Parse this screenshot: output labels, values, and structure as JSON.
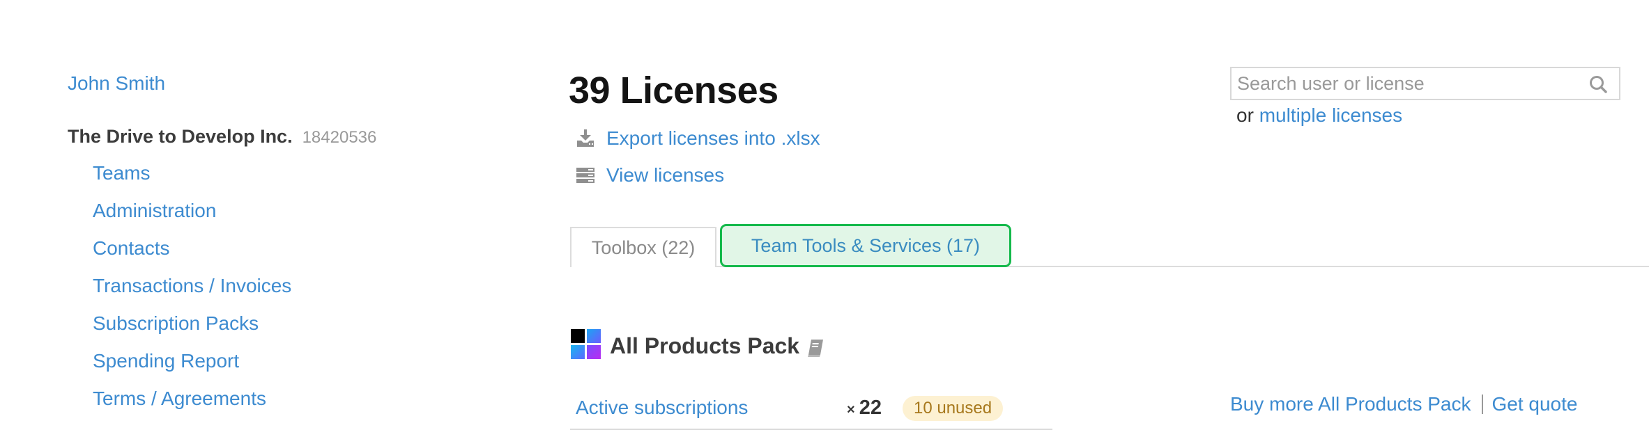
{
  "sidebar": {
    "user_name": "John Smith",
    "org_name": "The Drive to Develop Inc.",
    "org_id": "18420536",
    "items": [
      {
        "label": "Teams"
      },
      {
        "label": "Administration"
      },
      {
        "label": "Contacts"
      },
      {
        "label": "Transactions / Invoices"
      },
      {
        "label": "Subscription Packs"
      },
      {
        "label": "Spending Report"
      },
      {
        "label": "Terms / Agreements"
      }
    ]
  },
  "main": {
    "title": "39 Licenses",
    "actions": {
      "export": {
        "label": "Export licenses into .xlsx",
        "icon": "download-icon"
      },
      "view": {
        "label": "View licenses",
        "icon": "list-icon"
      }
    },
    "tabs": [
      {
        "label": "Toolbox (22)",
        "active": true
      },
      {
        "label": "Team Tools & Services (17)",
        "highlighted": true
      }
    ],
    "product": {
      "name": "All Products Pack",
      "doc_icon": "book-icon",
      "active_subscriptions_label": "Active subscriptions",
      "quantity_prefix": "×",
      "quantity": "22",
      "unused_badge": "10 unused"
    }
  },
  "search": {
    "placeholder": "Search user or license",
    "value": "",
    "or_text": "or",
    "multiple_link": "multiple licenses"
  },
  "purchase": {
    "buy_more_label": "Buy more All Products Pack",
    "get_quote_label": "Get quote"
  },
  "colors": {
    "link": "#3d8bd0",
    "highlight_border": "#14b94b",
    "highlight_bg": "#e1f6e7",
    "badge_bg": "#fdf1d2",
    "badge_text": "#a7781c"
  }
}
